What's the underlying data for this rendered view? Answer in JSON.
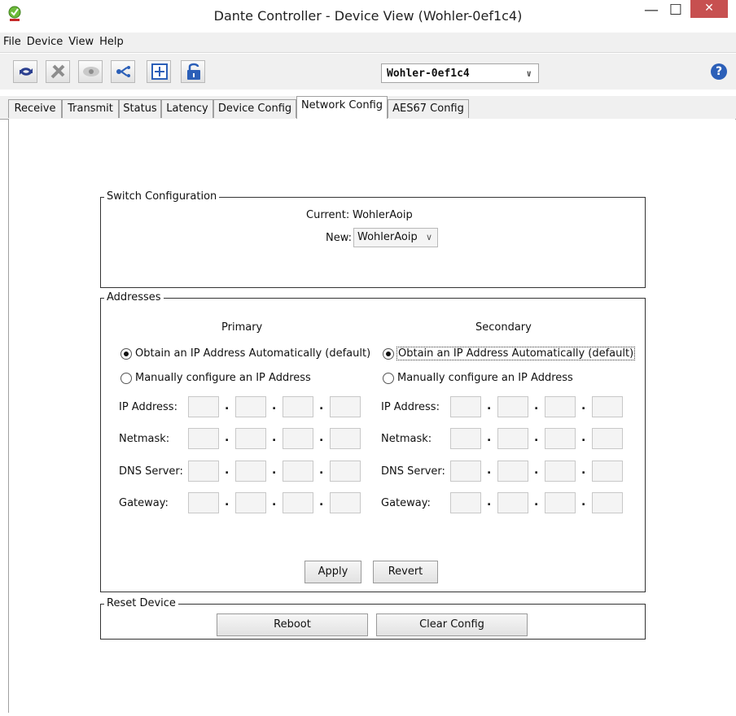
{
  "window": {
    "title": "Dante Controller - Device View (Wohler-0ef1c4)",
    "controls": {
      "minimize": "—",
      "maximize": "☐",
      "close": "✕"
    },
    "icon": "dante-controller-app-icon"
  },
  "menu": [
    "File",
    "Device",
    "View",
    "Help"
  ],
  "toolbar": {
    "buttons": [
      "refresh-icon",
      "tools-icon",
      "eye-icon",
      "network-icon",
      "add-device-icon",
      "unlock-icon"
    ],
    "device": "Wohler-0ef1c4",
    "help": "?"
  },
  "tabs": [
    "Receive",
    "Transmit",
    "Status",
    "Latency",
    "Device Config",
    "Network Config",
    "AES67 Config"
  ],
  "active_tab": "Network Config",
  "switch_config": {
    "legend": "Switch Configuration",
    "current_label": "Current:",
    "current_value": "WohlerAoip",
    "new_label": "New:",
    "new_value": "WohlerAoip"
  },
  "addresses": {
    "legend": "Addresses",
    "primary": {
      "heading": "Primary",
      "auto_label": "Obtain an IP Address Automatically (default)",
      "manual_label": "Manually configure an IP Address",
      "selected": "auto",
      "fields": [
        "IP Address:",
        "Netmask:",
        "DNS Server:",
        "Gateway:"
      ]
    },
    "secondary": {
      "heading": "Secondary",
      "auto_label": "Obtain an IP Address Automatically (default)",
      "manual_label": "Manually configure an IP Address",
      "selected": "auto",
      "fields": [
        "IP Address:",
        "Netmask:",
        "DNS Server:",
        "Gateway:"
      ]
    },
    "dot": ".",
    "apply": "Apply",
    "revert": "Revert"
  },
  "reset": {
    "legend": "Reset Device",
    "reboot": "Reboot",
    "clear": "Clear Config"
  }
}
